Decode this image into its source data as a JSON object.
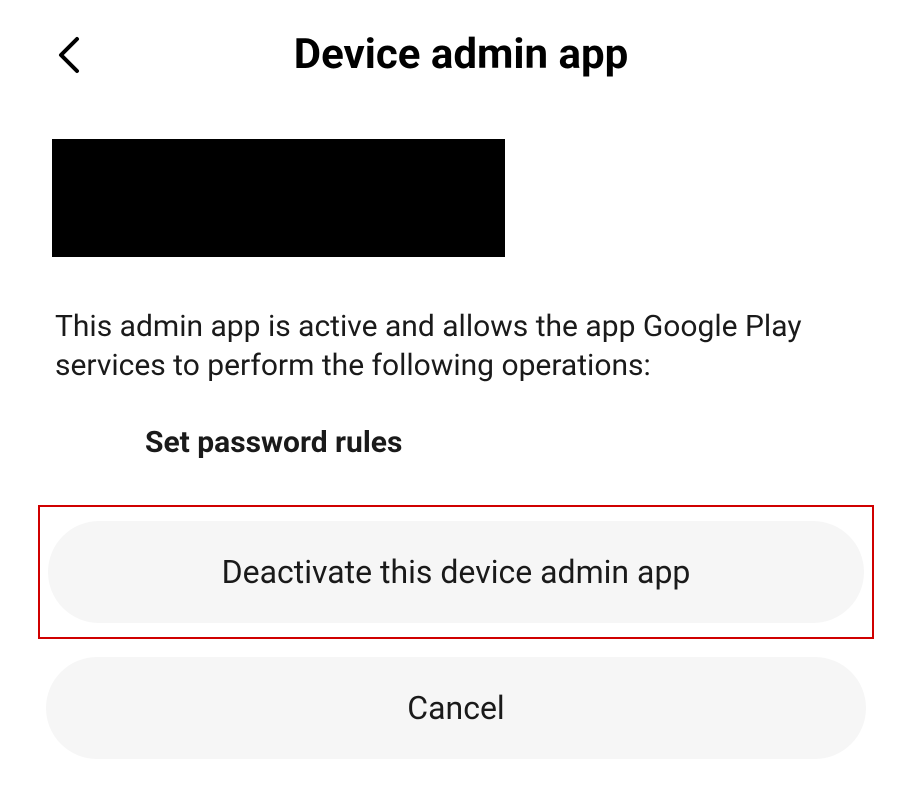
{
  "header": {
    "title": "Device admin app"
  },
  "content": {
    "description": "This admin app is active and allows the app Google Play services to perform the following operations:",
    "operations": [
      "Set password rules"
    ]
  },
  "buttons": {
    "deactivate_label": "Deactivate this device admin app",
    "cancel_label": "Cancel"
  }
}
